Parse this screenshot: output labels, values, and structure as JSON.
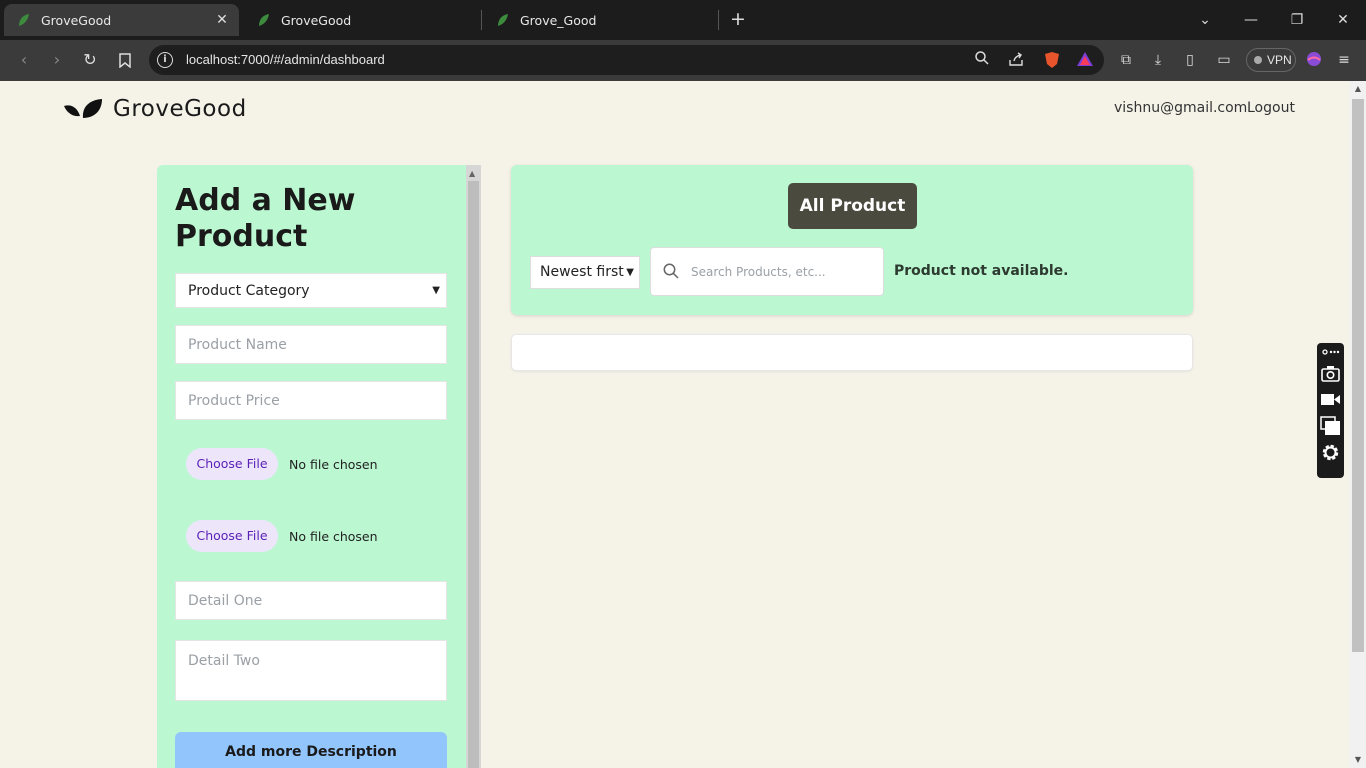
{
  "browser": {
    "tabs": [
      {
        "title": "GroveGood",
        "active": true
      },
      {
        "title": "GroveGood",
        "active": false
      },
      {
        "title": "Grove_Good",
        "active": false
      }
    ],
    "url": "localhost:7000/#/admin/dashboard",
    "vpn_label": "VPN"
  },
  "header": {
    "brand": "GroveGood",
    "user_email": "vishnu@gmail.com",
    "logout": "Logout"
  },
  "form": {
    "title": "Add a New Product",
    "category_selected": "Product Category",
    "product_name_placeholder": "Product Name",
    "product_price_placeholder": "Product Price",
    "file_button": "Choose File",
    "file_status": "No file chosen",
    "detail_one_placeholder": "Detail One",
    "detail_two_placeholder": "Detail Two",
    "add_description": "Add more Description"
  },
  "products": {
    "all_button": "All Product",
    "sort_selected": "Newest first",
    "search_placeholder": "Search Products, etc...",
    "empty_message": "Product not available."
  },
  "colors": {
    "page_bg": "#f5f2e8",
    "panel_green": "#bbf7d0",
    "dark_button": "#4a4a3f",
    "blue_button": "#93c5fd"
  }
}
